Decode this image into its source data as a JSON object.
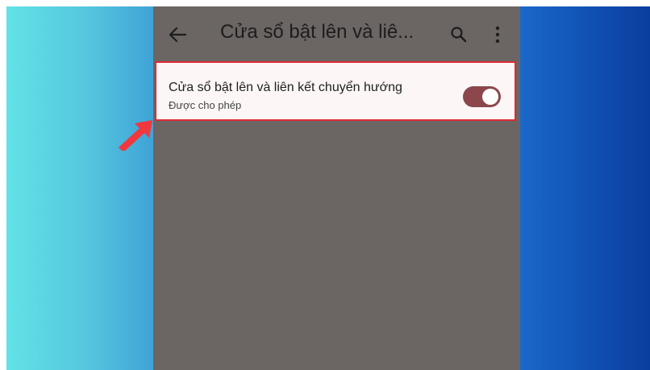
{
  "toolbar": {
    "title": "Cửa sổ bật lên và liê...",
    "back_icon": "arrow-left-icon",
    "search_icon": "search-icon",
    "more_icon": "more-vertical-icon"
  },
  "setting": {
    "label": "Cửa sổ bật lên và liên kết chuyển hướng",
    "status": "Được cho phép",
    "toggle_on": true
  },
  "colors": {
    "highlight_border": "#e02a34",
    "toggle_track": "#8b474c",
    "arrow": "#f0383e",
    "left_bg": "#5bd3e3",
    "right_bg": "#0f4fb3",
    "phone_bg": "#6b6563"
  }
}
